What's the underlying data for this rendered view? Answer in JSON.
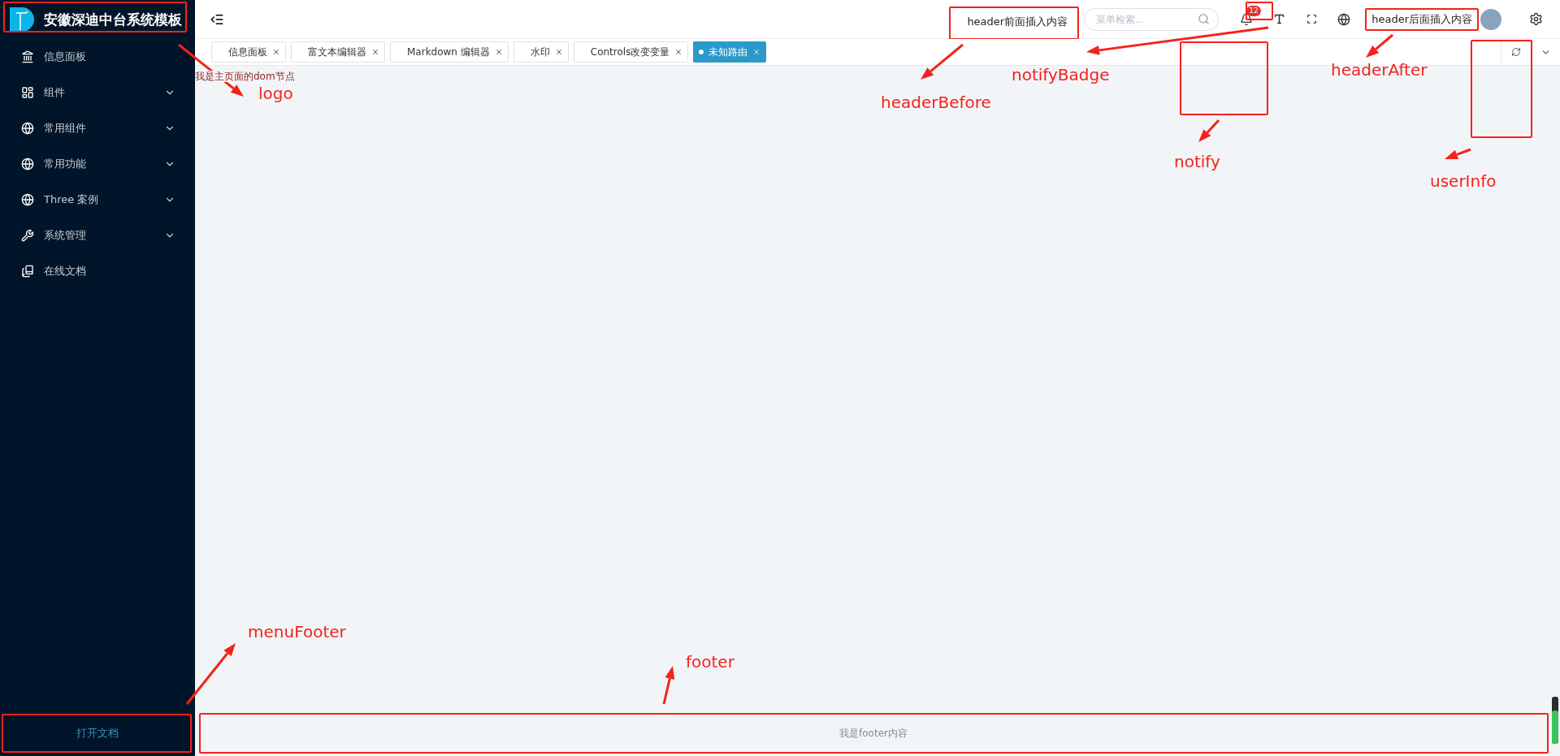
{
  "sidebar": {
    "logo": {
      "title": "安徽深迪中台系统模板"
    },
    "items": [
      {
        "label": "信息面板",
        "kind": "link"
      },
      {
        "label": "组件",
        "kind": "submenu",
        "expanded": false
      },
      {
        "label": "常用组件",
        "kind": "submenu",
        "expanded": false
      },
      {
        "label": "常用功能",
        "kind": "submenu",
        "expanded": false
      },
      {
        "label": "Three 案例",
        "kind": "submenu",
        "expanded": false
      },
      {
        "label": "系统管理",
        "kind": "submenu",
        "expanded": false
      },
      {
        "label": "在线文档",
        "kind": "link"
      }
    ],
    "menu_footer": "打开文档"
  },
  "header": {
    "header_before": "header前面插入内容",
    "search": {
      "placeholder": "菜单检索..."
    },
    "notify_badge": "12",
    "header_after": "header后面插入内容"
  },
  "tabs": [
    {
      "label": "信息面板",
      "selected": false
    },
    {
      "label": "富文本编辑器",
      "selected": false
    },
    {
      "label": "Markdown 编辑器",
      "selected": false
    },
    {
      "label": "水印",
      "selected": false
    },
    {
      "label": "Controls改变变量",
      "selected": false
    },
    {
      "label": "未知路由",
      "selected": true
    }
  ],
  "content": {
    "text": "我是主页面的dom节点"
  },
  "footer": "我是footer内容",
  "annotations": [
    {
      "label": "logo"
    },
    {
      "label": "headerBefore"
    },
    {
      "label": "notifyBadge"
    },
    {
      "label": "headerAfter"
    },
    {
      "label": "notify"
    },
    {
      "label": "userInfo"
    },
    {
      "label": "menuFooter"
    },
    {
      "label": "footer"
    }
  ]
}
